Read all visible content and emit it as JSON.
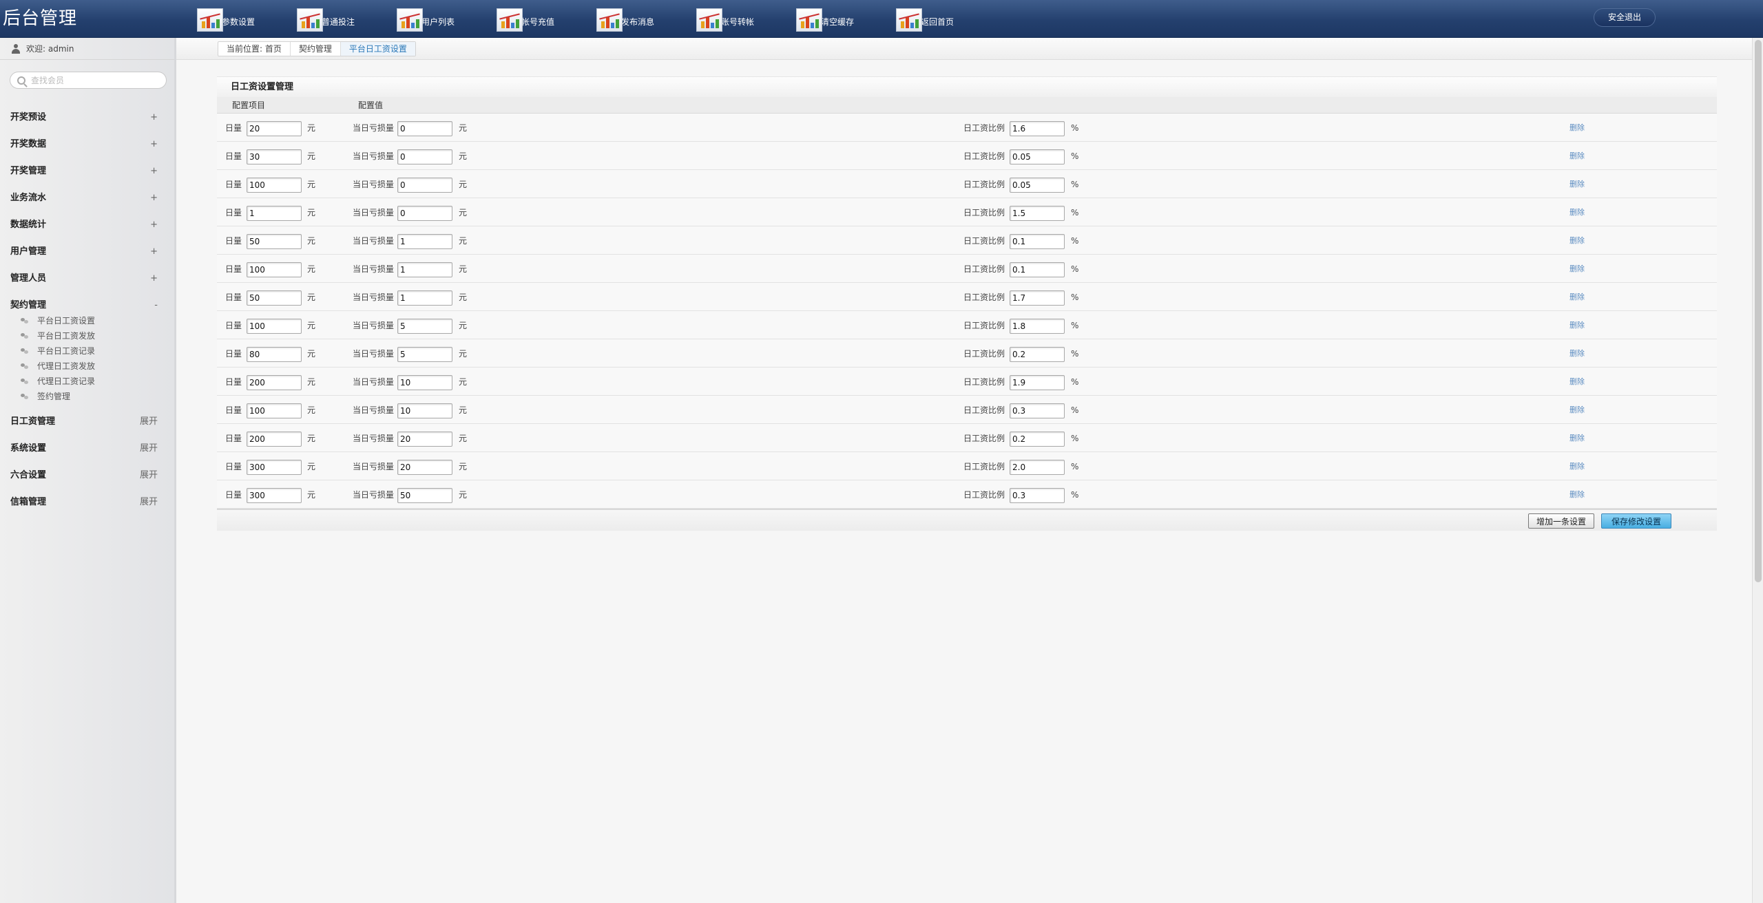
{
  "header": {
    "brand": "后台管理",
    "nav": [
      {
        "label": "参数设置",
        "icon": "chart-icon"
      },
      {
        "label": "普通投注",
        "icon": "chart-icon"
      },
      {
        "label": "用户列表",
        "icon": "chart-icon"
      },
      {
        "label": "帐号充值",
        "icon": "chart-icon"
      },
      {
        "label": "发布消息",
        "icon": "chart-icon"
      },
      {
        "label": "账号转帐",
        "icon": "chart-icon"
      },
      {
        "label": "清空缓存",
        "icon": "chart-icon"
      },
      {
        "label": "返回首页",
        "icon": "chart-icon"
      }
    ],
    "logout": "安全退出"
  },
  "sidebar": {
    "welcome": "欢迎: admin",
    "search_placeholder": "查找会员",
    "menu": [
      {
        "label": "开奖预设",
        "sign": "+"
      },
      {
        "label": "开奖数据",
        "sign": "+"
      },
      {
        "label": "开奖管理",
        "sign": "+"
      },
      {
        "label": "业务流水",
        "sign": "+"
      },
      {
        "label": "数据统计",
        "sign": "+"
      },
      {
        "label": "用户管理",
        "sign": "+"
      },
      {
        "label": "管理人员",
        "sign": "+"
      },
      {
        "label": "契约管理",
        "sign": "-"
      },
      {
        "label": "日工资管理",
        "sign": "展开"
      },
      {
        "label": "系统设置",
        "sign": "展开"
      },
      {
        "label": "六合设置",
        "sign": "展开"
      },
      {
        "label": "信箱管理",
        "sign": "展开"
      }
    ],
    "contract_sub": [
      "平台日工资设置",
      "平台日工资发放",
      "平台日工资记录",
      "代理日工资发放",
      "代理日工资记录",
      "签约管理"
    ]
  },
  "breadcrumb": {
    "prefix": "当前位置: 首页",
    "level1": "契约管理",
    "current": "平台日工资设置"
  },
  "panel": {
    "title": "日工资设置管理",
    "col_item": "配置项目",
    "col_value": "配置值",
    "label_volume": "日量",
    "label_loss": "当日亏损量",
    "label_ratio": "日工资比例",
    "unit_yuan": "元",
    "unit_pct": "%",
    "delete": "删除",
    "rows": [
      {
        "volume": "20",
        "loss": "0",
        "ratio": "1.6"
      },
      {
        "volume": "30",
        "loss": "0",
        "ratio": "0.05"
      },
      {
        "volume": "100",
        "loss": "0",
        "ratio": "0.05"
      },
      {
        "volume": "1",
        "loss": "0",
        "ratio": "1.5"
      },
      {
        "volume": "50",
        "loss": "1",
        "ratio": "0.1"
      },
      {
        "volume": "100",
        "loss": "1",
        "ratio": "0.1"
      },
      {
        "volume": "50",
        "loss": "1",
        "ratio": "1.7"
      },
      {
        "volume": "100",
        "loss": "5",
        "ratio": "1.8"
      },
      {
        "volume": "80",
        "loss": "5",
        "ratio": "0.2"
      },
      {
        "volume": "200",
        "loss": "10",
        "ratio": "1.9"
      },
      {
        "volume": "100",
        "loss": "10",
        "ratio": "0.3"
      },
      {
        "volume": "200",
        "loss": "20",
        "ratio": "0.2"
      },
      {
        "volume": "300",
        "loss": "20",
        "ratio": "2.0"
      },
      {
        "volume": "300",
        "loss": "50",
        "ratio": "0.3"
      }
    ],
    "add_button": "增加一条设置",
    "save_button": "保存修改设置"
  }
}
